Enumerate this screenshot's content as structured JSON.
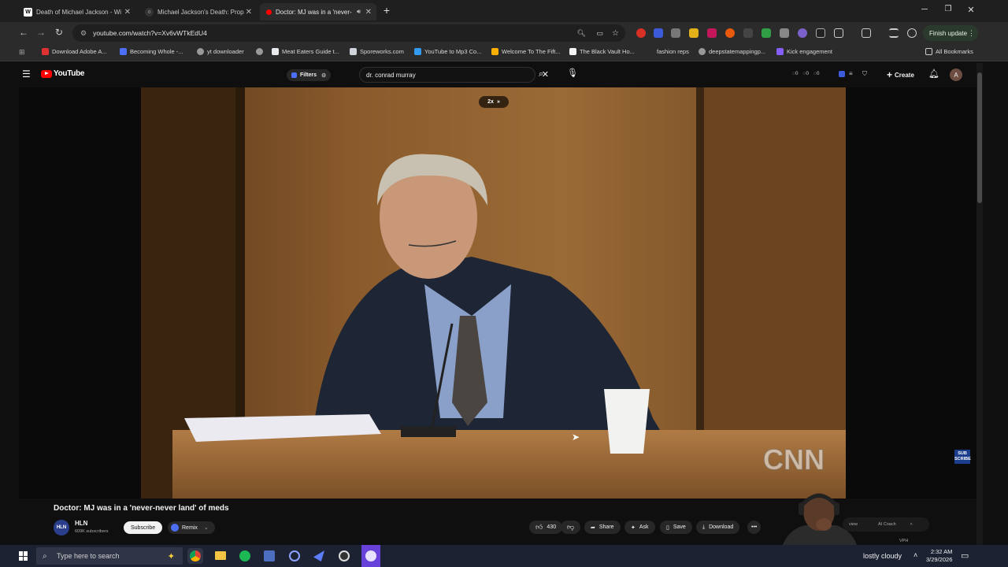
{
  "browser": {
    "tabs": [
      {
        "title": "Death of Michael Jackson - Wi",
        "favicon": "W",
        "active": false
      },
      {
        "title": "Michael Jackson's Death: Prop",
        "favicon": "O",
        "active": false
      },
      {
        "title": "Doctor: MJ was in a 'never-",
        "favicon": "yt",
        "active": true
      }
    ],
    "new_tab": "+",
    "url": "youtube.com/watch?v=Xv6vWTkEdU4",
    "finish_update": "Finish update",
    "bookmarks": [
      {
        "label": "Download Adobe A..."
      },
      {
        "label": "Becoming Whole -..."
      },
      {
        "label": "yt downloader"
      },
      {
        "label": ""
      },
      {
        "label": "Meat Eaters Guide t..."
      },
      {
        "label": "Sporeworks.com"
      },
      {
        "label": "YouTube to Mp3 Co..."
      },
      {
        "label": "Welcome To The Fift..."
      },
      {
        "label": "The Black Vault Ho..."
      },
      {
        "label": "fashion reps"
      },
      {
        "label": "deepstatemappingp..."
      },
      {
        "label": "Kick engagement"
      }
    ],
    "all_bookmarks": "All Bookmarks"
  },
  "youtube": {
    "logo_text": "YouTube",
    "filters_label": "Filters",
    "search_value": "dr. conrad murray",
    "header_counts": [
      "0",
      "0",
      "0"
    ],
    "create_label": "Create",
    "avatar_letter": "A",
    "speed_label": "2x",
    "watermark": "CNN",
    "sub_badge": "SUB\nSCRIBE",
    "video_title": "Doctor: MJ was in a 'never-never land' of meds",
    "channel": {
      "avatar": "HLN",
      "name": "HLN",
      "subscribers": "609K subscribers"
    },
    "subscribe_label": "Subscribe",
    "remix_label": "Remix",
    "likes": "430",
    "share_label": "Share",
    "ask_label": "Ask",
    "save_label": "Save",
    "download_label": "Download",
    "overlay": {
      "preview_label": "view",
      "coach_label": "AI Coach",
      "vph_label": "VPH"
    }
  },
  "taskbar": {
    "search_placeholder": "Type here to search",
    "weather": "lostly cloudy",
    "time": "2:32 AM",
    "date": "3/29/2026"
  },
  "colors": {
    "yt_red": "#ff0000",
    "background": "#0f0f0f",
    "taskbar": "#1c2232"
  }
}
